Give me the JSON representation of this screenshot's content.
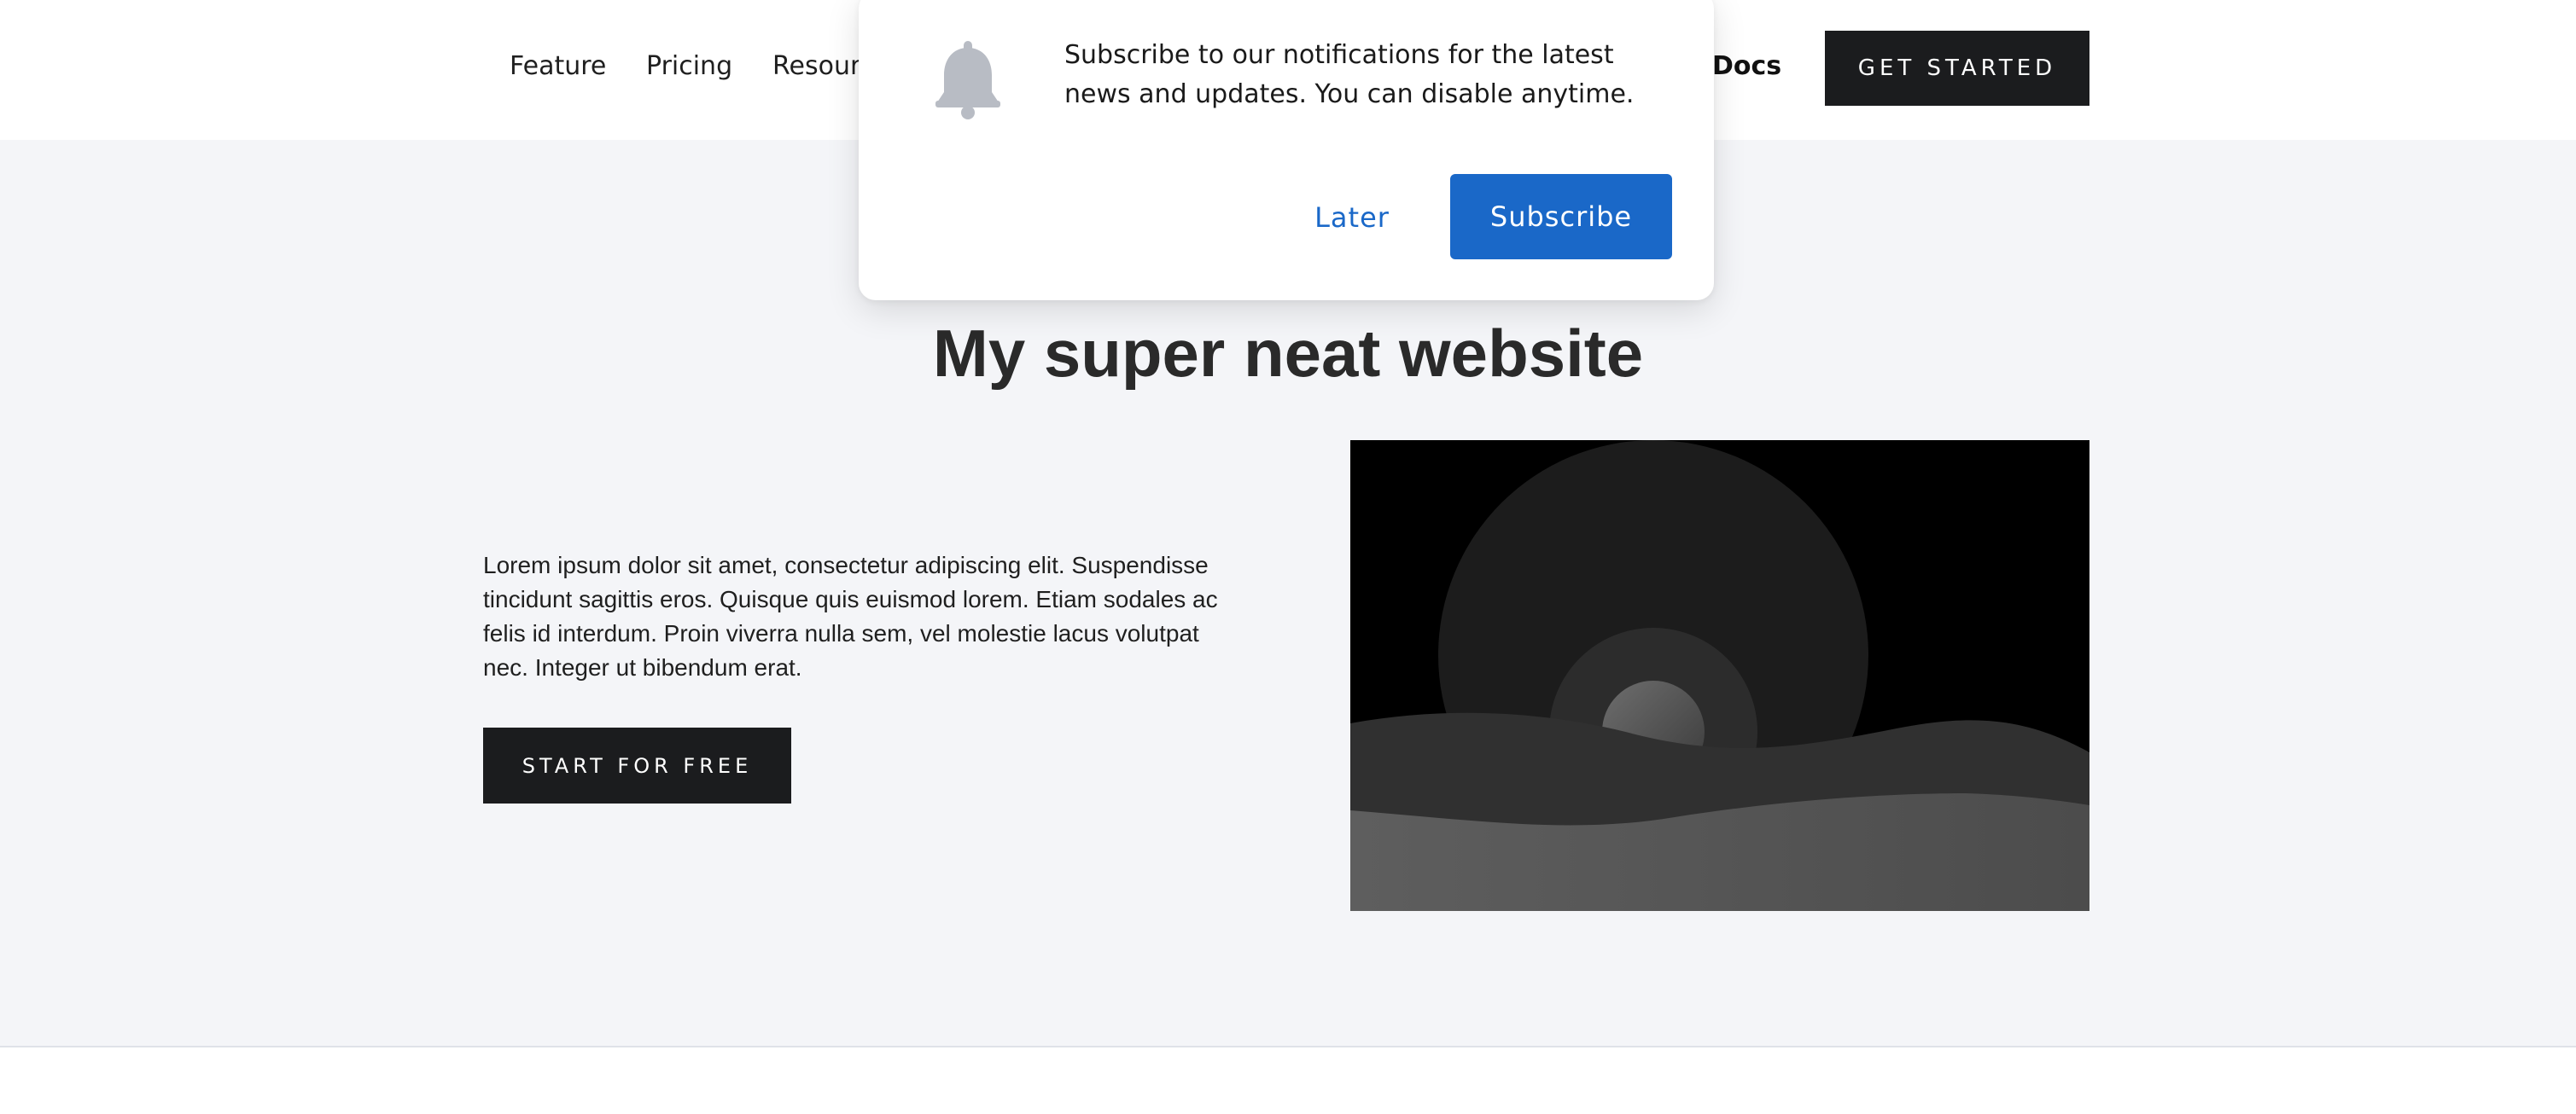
{
  "nav": {
    "links": [
      "Feature",
      "Pricing",
      "Resources"
    ],
    "docs_label": "Docs",
    "cta_label": "GET STARTED"
  },
  "hero": {
    "title": "My super neat website",
    "body": "Lorem ipsum dolor sit amet, consectetur adipiscing elit. Suspendisse tincidunt sagittis eros. Quisque quis euismod lorem. Etiam sodales ac felis id interdum. Proin viverra nulla sem, vel molestie lacus volutpat nec. Integer ut bibendum erat.",
    "cta_label": "START FOR FREE"
  },
  "notification": {
    "icon": "bell-icon",
    "message": "Subscribe to our notifications for the latest news and updates. You can disable anytime.",
    "later_label": "Later",
    "subscribe_label": "Subscribe"
  },
  "colors": {
    "dark_button": "#1b1c1e",
    "accent_blue": "#1a68c8",
    "hero_background": "#f4f5f8",
    "bell_gray": "#b8bcc4"
  }
}
